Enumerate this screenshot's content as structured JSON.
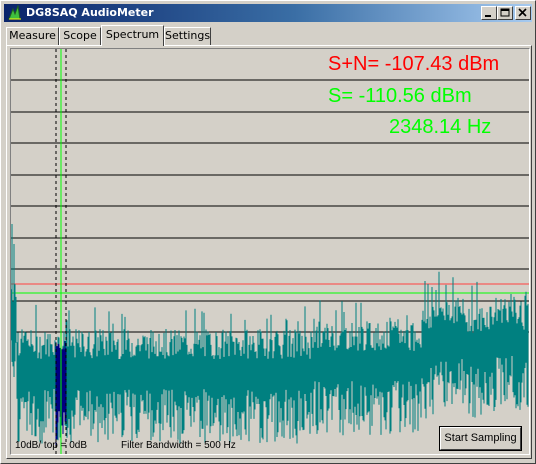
{
  "window": {
    "title": "DG8SAQ AudioMeter",
    "controls": [
      "minimize-icon",
      "maximize-icon",
      "close-icon"
    ]
  },
  "tabs": [
    {
      "label": "Measure",
      "active": false
    },
    {
      "label": "Scope",
      "active": false
    },
    {
      "label": "Spectrum",
      "active": true
    },
    {
      "label": "Settings",
      "active": false
    }
  ],
  "readouts": {
    "signal_noise": "S+N= -107.43 dBm",
    "signal": "S= -110.56 dBm",
    "frequency": "2348.14 Hz"
  },
  "footer": {
    "scale": "10dB/  top = 0dB",
    "filter": "Filter Bandwidth = 500 Hz"
  },
  "buttons": {
    "start_sampling": "Start Sampling"
  },
  "colors": {
    "signal_noise_text": "#ff0000",
    "signal_text": "#00ff00",
    "frequency_text": "#00ff00",
    "spectrum_trace": "#008080",
    "marker_trace": "#000080",
    "green_level_line": "#00ff00",
    "red_level_line": "#ff4040",
    "grid_line": "#000000"
  },
  "chart_data": {
    "type": "line",
    "y_scale_per_div": "10dB",
    "top_level": "0dB",
    "grid": true
  }
}
